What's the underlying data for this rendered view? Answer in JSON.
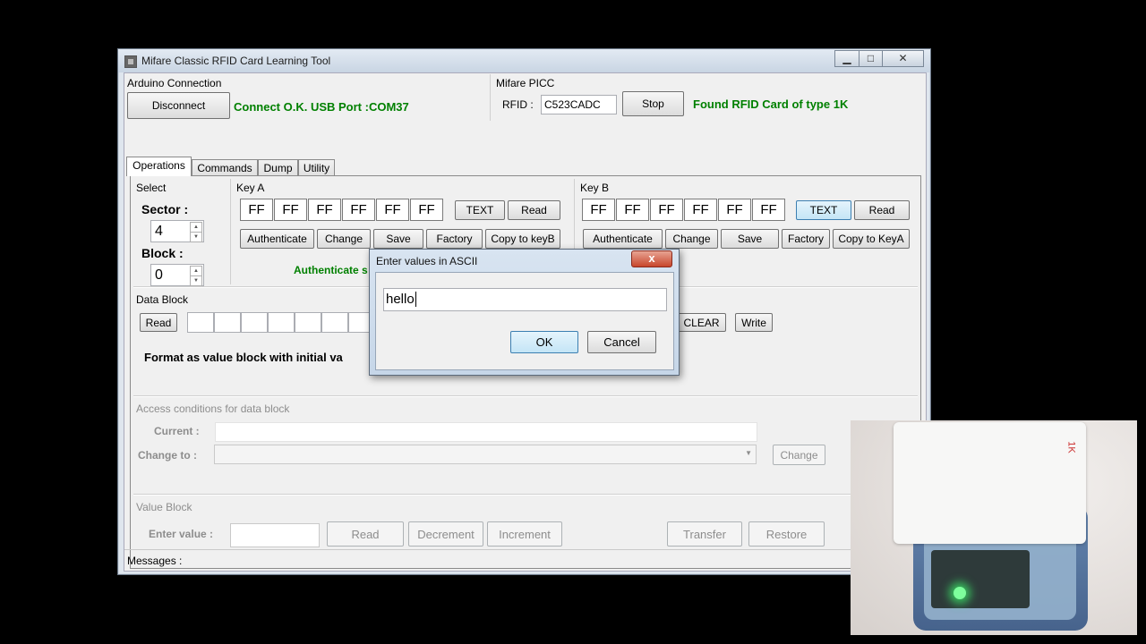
{
  "window": {
    "title": "Mifare Classic RFID Card Learning Tool",
    "min_label": "▁",
    "max_label": "□",
    "close_label": "✕"
  },
  "arduino": {
    "group_label": "Arduino Connection",
    "disconnect_label": "Disconnect",
    "status": "Connect O.K. USB Port :COM37"
  },
  "picc": {
    "group_label": "Mifare  PICC",
    "rfid_label": "RFID :",
    "rfid_value": "C523CADC",
    "stop_label": "Stop",
    "status": "Found RFID Card of type 1K"
  },
  "tabs": [
    {
      "label": "Operations",
      "active": true
    },
    {
      "label": "Commands",
      "active": false
    },
    {
      "label": "Dump",
      "active": false
    },
    {
      "label": "Utility",
      "active": false
    }
  ],
  "select": {
    "group_label": "Select",
    "sector_label": "Sector :",
    "sector_value": "4",
    "block_label": "Block :",
    "block_value": "0"
  },
  "key_a": {
    "group_label": "Key A",
    "bytes": [
      "FF",
      "FF",
      "FF",
      "FF",
      "FF",
      "FF"
    ],
    "text_label": "TEXT",
    "read_label": "Read",
    "authenticate_label": "Authenticate",
    "change_label": "Change",
    "save_label": "Save",
    "factory_label": "Factory",
    "copy_label": "Copy to keyB",
    "status": "Authenticate s"
  },
  "key_b": {
    "group_label": "Key B",
    "bytes": [
      "FF",
      "FF",
      "FF",
      "FF",
      "FF",
      "FF"
    ],
    "text_label": "TEXT",
    "read_label": "Read",
    "authenticate_label": "Authenticate",
    "change_label": "Change",
    "save_label": "Save",
    "factory_label": "Factory",
    "copy_label": "Copy to KeyA"
  },
  "data_block": {
    "group_label": "Data Block",
    "read_label": "Read",
    "clear_label": "CLEAR",
    "write_label": "Write",
    "format_text": "Format as value block with initial va"
  },
  "access": {
    "group_label": "Access conditions for data block",
    "current_label": "Current :",
    "change_to_label": "Change to :",
    "change_label": "Change"
  },
  "value_block": {
    "group_label": "Value Block",
    "enter_label": "Enter value :",
    "read_label": "Read",
    "decrement_label": "Decrement",
    "increment_label": "Increment",
    "transfer_label": "Transfer",
    "restore_label": "Restore"
  },
  "messages_label": "Messages :",
  "dialog": {
    "title": "Enter values in ASCII",
    "close_label": "x",
    "input_value": "hello",
    "ok_label": "OK",
    "cancel_label": "Cancel"
  },
  "video": {
    "card_mark": "1K"
  }
}
